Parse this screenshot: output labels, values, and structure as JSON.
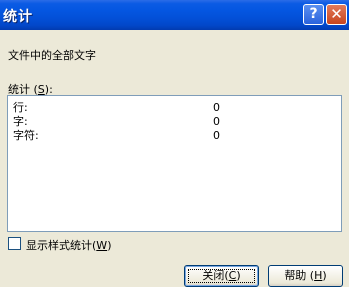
{
  "window": {
    "title": "统计",
    "help_button": "?",
    "close_button": "✕"
  },
  "section": {
    "doc_stats_label": "文件中的全部文字",
    "stats_label_prefix": "统计 (",
    "stats_label_accel": "S",
    "stats_label_suffix": "):"
  },
  "stats": [
    {
      "name": "行:",
      "value": "0"
    },
    {
      "name": "字:",
      "value": "0"
    },
    {
      "name": "字符:",
      "value": "0"
    }
  ],
  "options": {
    "show_style_stats_prefix": "显示样式统计(",
    "show_style_stats_accel": "W",
    "show_style_stats_suffix": ")",
    "checked": false
  },
  "buttons": {
    "close_prefix": "关闭(",
    "close_accel": "C",
    "close_suffix": ")",
    "help_prefix": "帮助 (",
    "help_accel": "H",
    "help_suffix": ")"
  }
}
